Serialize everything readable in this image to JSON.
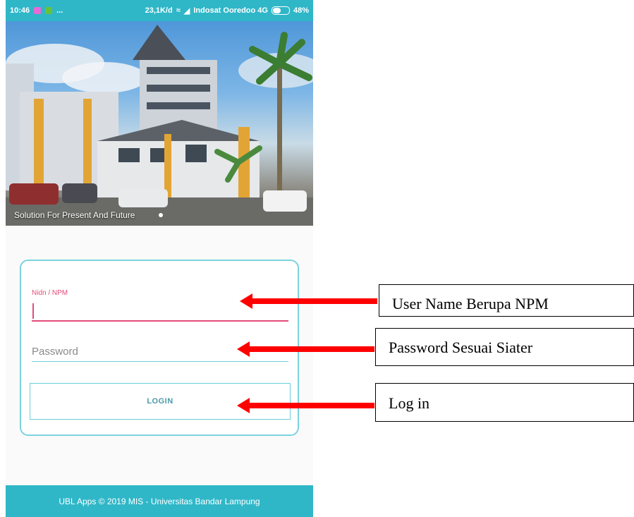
{
  "status_bar": {
    "time": "10:46",
    "notifications": "...",
    "net_speed": "23,1K/d",
    "carrier": "Indosat Ooredoo 4G",
    "battery": "48%"
  },
  "hero": {
    "caption": "Solution For Present And Future"
  },
  "login_form": {
    "npm_label": "Nidn / NPM",
    "npm_value": "",
    "password_placeholder": "Password",
    "login_label": "LOGIN"
  },
  "footer": {
    "text": "UBL Apps © 2019 MIS - Universitas Bandar Lampung"
  },
  "annotations": {
    "username": "User Name Berupa NPM",
    "password": "Password Sesuai Siater",
    "login": "Log in"
  },
  "colors": {
    "status_bar": "#2fb7c8",
    "accent_pink": "#e34c7a",
    "card_border": "#7bd3dc",
    "arrow": "#ff0000"
  }
}
